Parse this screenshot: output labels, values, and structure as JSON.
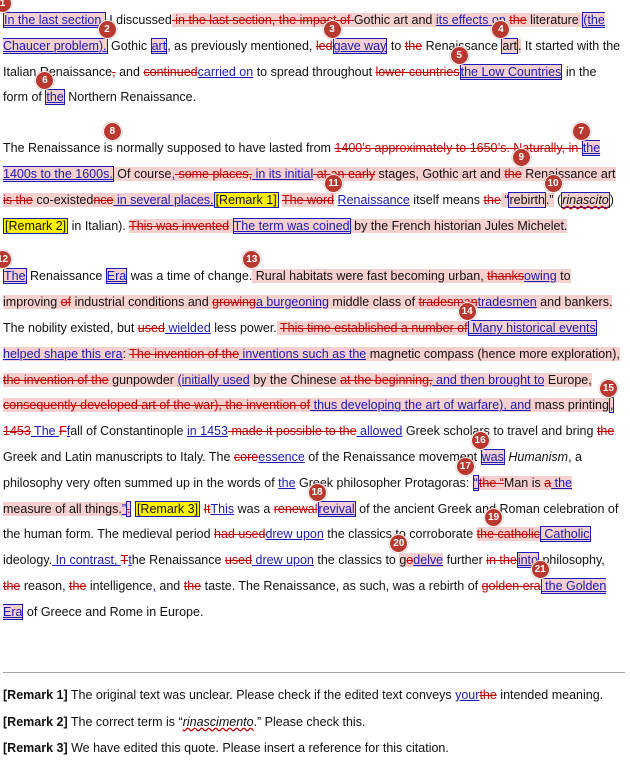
{
  "p1": {
    "b1": "1",
    "t1": "In the last section,",
    "t2": " I discussed",
    "t3": " in the last section, the impact of ",
    "t4": "Gothic art and ",
    "t5": "its effects on",
    "t6": " ",
    "t7": "the",
    "t8": " literature ",
    "t9": "(the Chaucer problem).",
    "b2": "2",
    "t10": " Gothic ",
    "t11": "art",
    "t12": ", as previously mentioned, ",
    "t13": "led",
    "b3": "3",
    "t14": "gave way",
    "t15": " to ",
    "t16": "the",
    "t17": " Renaissance ",
    "b4": "4",
    "t18": "art",
    "t19": ".",
    "t20": " It started with the Italian Renaissance",
    "t21": ",",
    "t22": " and ",
    "t23": "continued",
    "t24": "carried on",
    "t25": " to spread throughout ",
    "t26": "lower countries",
    "b5": "5",
    "t27": "the Low Countries",
    "t28": " in the form of ",
    "b6": "6",
    "t29": "the",
    "t30": " Northern Renaissance."
  },
  "p2": {
    "t1": "The Renaissance is",
    "b8": "8",
    "t2": " normally supposed to have lasted from ",
    "t3": "1400’s approximately to 1650’s. Naturally, in ",
    "b7": "7",
    "t4": "the 1400s to the 1600s.",
    "t5": " Of course",
    "t6": ",",
    "t7": " some places,",
    "t8": " in its initial",
    "t9": " at an early",
    "t10": " stages, Gothic art and ",
    "t11": "the",
    "b9": "9",
    "t12": " Renaissance art ",
    "t13": "is the",
    "t14": " co-existed",
    "t15": "nce",
    "t16": " in several places.",
    "r1": "[Remark 1]",
    "t17": " ",
    "t18": "The word",
    "b11": "11",
    "t19": " ",
    "t20": "Renaissance",
    "t21": " itself means ",
    "t22": "the",
    "t23": " “",
    "t24": "rebirth",
    "t25": ".”",
    "b10": "10",
    "t26": " (",
    "t27": "rinascito",
    "t28": ")",
    "t29": " ",
    "r2": "[Remark 2]",
    "t30": " in Italian). ",
    "t31": "This was invented",
    "t32": " ",
    "t33": "The term was coined",
    "t34": " by the French historian Jules Michelet."
  },
  "p3": {
    "b12": "12",
    "t1": "The",
    "t2": " Renaissance ",
    "t3": "Era",
    "t4": " was a time of change.",
    "b13": "13",
    "t5": " Rural habitats were fast becoming urban, ",
    "t6": "thanks",
    "t7": "owing",
    "t8": " to improving ",
    "t9": "of",
    "t10": " industrial conditions and ",
    "t11": "growing",
    "t12": "a burgeoning",
    "t13": " middle class of ",
    "t14": "tradesman",
    "t15": "tradesmen",
    "t16": " and bankers.",
    "t17": " The nobility existed, but ",
    "t18": "used",
    "t19": " wielded",
    "t20": " less power.",
    "t21": " ",
    "t22": "This time established a number of",
    "b14": "14",
    "t23": " Many historical events",
    "t24": " helped shape this era",
    "t25": ": ",
    "t26": "The invention of the",
    "t27": " inventions such as the",
    "t28": " magnetic compass (hence more exploration), ",
    "t29": "the invention of the",
    "t30": " gunpowder ",
    "t31": "(initially used",
    "t32": " by the Chinese ",
    "t33": "at the beginning,",
    "t34": " and then brought ",
    "t35": "to",
    "t36": " Europe, ",
    "t37": "consequently developed art of the war), the invention of",
    "t38": " thus developing the art of warfare), and",
    "t39": " mass printing",
    "b15": "15",
    "t40": ", ",
    "t41": "1453",
    "t42": " The ",
    "t43": "F",
    "t44": "f",
    "t45": "all of Constantinople ",
    "t46": "in 1453",
    "t47": " made it possible to the",
    "t48": " allowed",
    "t49": " Greek scholars to travel and bring ",
    "t50": "the",
    "t51": " Greek and Latin manuscripts to Italy.",
    "t52": " The ",
    "t53": "core",
    "t54": "essence",
    "t55": " of the Renaissance movement ",
    "b16": "16",
    "t56": "was",
    "t57": " ",
    "t58": "Humanism",
    "t59": ", a philosophy very often summed up in the words of ",
    "t60": "the",
    "t61": " Greek philosopher Protagoras",
    "b17": "17",
    "t62": ": ",
    "t63": "“",
    "t64": "the “",
    "t65": "Man is ",
    "t66": "a",
    "t67": " the",
    "t68": " measure of all things.",
    "t69": "”",
    "t70": ".",
    "t71": " ",
    "r3": "[Remark 3]",
    "t72": " ",
    "t73": "It",
    "t74": "This",
    "t75": " was a ",
    "t76": "renewal",
    "b18": "18",
    "t77": "revival",
    "t78": " of the ancient Greek and Roman celebration of the human form.",
    "t79": " The medieval period ",
    "t80": "had used",
    "t81": "drew upon",
    "t82": " the classics to corroborate ",
    "t83": "the",
    "b19": "19",
    "t84": " catholic",
    "t85": " Catholic",
    "t86": " ideology.",
    "t87": " In contrast, ",
    "t88": "T",
    "t89": "t",
    "t90": "he Renaissance ",
    "t91": "used",
    "t92": " drew upon",
    "t93": " the classics to ",
    "b20": "20",
    "t94": "g",
    "t95": "o",
    "t96": "delve",
    "t97": " further ",
    "t98": "in the",
    "t99": "into",
    "t100": " philosophy, ",
    "t101": "the",
    "t102": " reason, ",
    "t103": "the",
    "t104": " intelligence",
    "t105": ",",
    "t106": " and ",
    "t107": "the",
    "t108": " taste.",
    "t109": " The Renaissance, as such, was a rebirth of ",
    "t110": "golden era",
    "b21": "21",
    "t111": " the Golden Era",
    "t112": " of Greece and Rome in Europe."
  },
  "notes": {
    "n1_label": "[Remark 1]",
    "n1_a": "  The original text was unclear. Please check if the edited text conveys ",
    "n1_ins": "your",
    "n1_del": "the",
    "n1_b": " intended meaning.",
    "n2_label": "[Remark 2]",
    "n2_a": "  The correct term is “",
    "n2_term": "rinascimento",
    "n2_b": ".” Please check this.",
    "n3_label": "[Remark 3]",
    "n3_a": "  We have edited this quote. Please insert a reference for this citation."
  },
  "colors": {
    "insert": "#1a1ab8",
    "delete": "#c40000",
    "comment_highlight": "#f6cfcf",
    "remark_highlight": "#fff200",
    "badge": "#b9382f"
  }
}
